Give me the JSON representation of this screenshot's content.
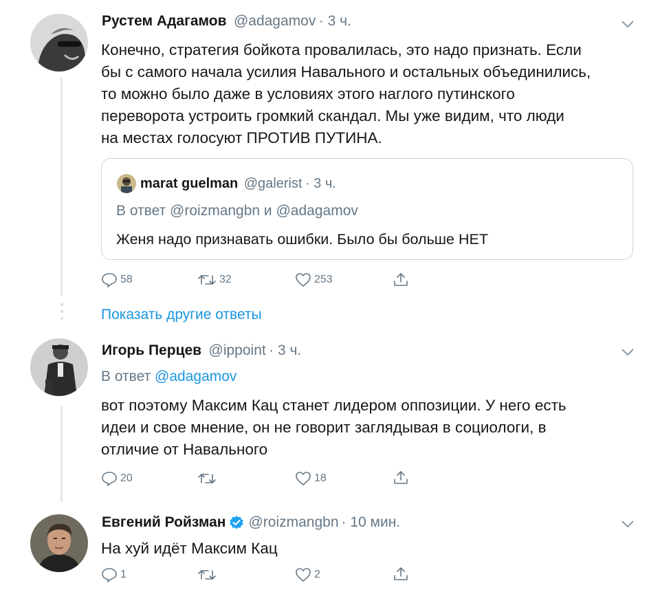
{
  "colors": {
    "link": "#1b95e0",
    "muted": "#657786",
    "text": "#14171a",
    "border": "#ccd6dd",
    "verified": "#1da1f2"
  },
  "tweets": [
    {
      "author_name": "Рустем Адагамов",
      "handle": "@adagamov",
      "time": "· 3 ч.",
      "text_lines": [
        "Конечно, стратегия бойкота провалилась, это надо признать. Если",
        "бы с самого начала усилия Навального и остальных объединились,",
        "то можно было даже в условиях этого наглого путинского",
        "переворота устроить громкий скандал. Мы уже видим, что люди",
        "на местах голосуют ПРОТИВ ПУТИНА."
      ],
      "quote": {
        "author_name": "marat guelman",
        "handle": "@galerist",
        "time": "· 3 ч.",
        "reply_prefix": "В ответ",
        "reply_to": "@roizmangbn и @adagamov",
        "text": "Женя надо признавать ошибки. Было бы больше НЕТ"
      },
      "actions": {
        "replies": "58",
        "retweets": "32",
        "likes": "253"
      },
      "icons": [
        "reply-icon",
        "retweet-icon",
        "like-icon",
        "share-icon",
        "chevron-down-icon"
      ]
    },
    {
      "author_name": "Игорь Перцев",
      "handle": "@ippoint",
      "time": "· 3 ч.",
      "reply_prefix": "В ответ",
      "reply_to": "@adagamov",
      "text_lines": [
        "вот поэтому Максим Кац станет лидером оппозиции. У него есть",
        "идеи и свое мнение, он не говорит заглядывая в социологи, в",
        "отличие от Навального"
      ],
      "actions": {
        "replies": "20",
        "retweets": "",
        "likes": "18"
      }
    },
    {
      "author_name": "Евгений Ройзман",
      "verified": true,
      "handle": "@roizmangbn",
      "time": "· 10 мин.",
      "text": "На хуй идёт Максим Кац",
      "actions": {
        "replies": "1",
        "retweets": "",
        "likes": "2"
      }
    }
  ],
  "show_more_replies": "Показать другие ответы"
}
